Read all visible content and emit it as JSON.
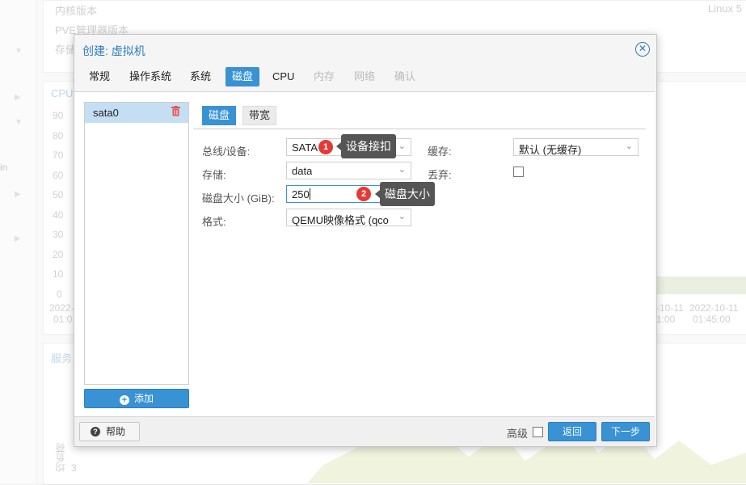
{
  "background": {
    "info_labels": [
      "内核版本",
      "PVE管理器版本",
      "存储"
    ],
    "kernel_value": "Linux 5",
    "cpu_title": "CPU",
    "service_title": "服务",
    "left_text": "in",
    "y_ticks": [
      "90",
      "80",
      "70",
      "60",
      "50",
      "40",
      "30",
      "20",
      "10",
      "0"
    ],
    "x_tick_left": [
      "2022-",
      "01:0"
    ],
    "x_tick_mid": [
      "-10-11",
      "1:00"
    ],
    "x_tick_right": [
      "2022-10-11",
      "01:45:00"
    ],
    "load_axis": "均负荷",
    "load_tick": "3"
  },
  "dialog": {
    "title": "创建: 虚拟机",
    "close_glyph": "✕",
    "tabs": [
      {
        "label": "常规",
        "state": "normal"
      },
      {
        "label": "操作系统",
        "state": "normal"
      },
      {
        "label": "系统",
        "state": "normal"
      },
      {
        "label": "磁盘",
        "state": "active"
      },
      {
        "label": "CPU",
        "state": "normal"
      },
      {
        "label": "内存",
        "state": "disabled"
      },
      {
        "label": "网络",
        "state": "disabled"
      },
      {
        "label": "确认",
        "state": "disabled"
      }
    ],
    "disk_list": {
      "items": [
        "sata0"
      ],
      "add_label": "添加"
    },
    "subtabs": [
      "磁盘",
      "带宽"
    ],
    "form": {
      "bus_label": "总线/设备:",
      "bus_value": "SATA",
      "storage_label": "存储:",
      "storage_value": "data",
      "size_label": "磁盘大小 (GiB):",
      "size_value": "250",
      "format_label": "格式:",
      "format_value": "QEMU映像格式 (qco",
      "cache_label": "缓存:",
      "cache_value": "默认 (无缓存)",
      "discard_label": "丢弃:"
    },
    "annotations": [
      {
        "number": "1",
        "text": "设备接扣"
      },
      {
        "number": "2",
        "text": "磁盘大小"
      }
    ],
    "footer": {
      "help_label": "帮助",
      "advanced_label": "高级",
      "back_label": "返回",
      "next_label": "下一步"
    }
  },
  "colors": {
    "accent": "#3892d4",
    "badge": "#e53935",
    "tooltip": "#555555",
    "title": "#2f7dc0"
  }
}
